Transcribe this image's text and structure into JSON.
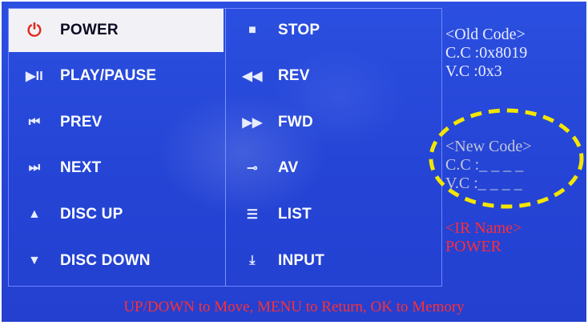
{
  "menu": {
    "left": [
      {
        "icon": "power-icon",
        "glyph": "⏻",
        "label": "POWER",
        "selected": true
      },
      {
        "icon": "play-pause-icon",
        "glyph": "▶II",
        "label": "PLAY/PAUSE"
      },
      {
        "icon": "prev-icon",
        "glyph": "⏮",
        "label": "PREV"
      },
      {
        "icon": "next-icon",
        "glyph": "⏭",
        "label": "NEXT"
      },
      {
        "icon": "disc-up-icon",
        "glyph": "▲",
        "label": "DISC UP"
      },
      {
        "icon": "disc-down-icon",
        "glyph": "▼",
        "label": "DISC DOWN"
      }
    ],
    "right": [
      {
        "icon": "stop-icon",
        "glyph": "■",
        "label": "STOP"
      },
      {
        "icon": "rev-icon",
        "glyph": "◀◀",
        "label": "REV"
      },
      {
        "icon": "fwd-icon",
        "glyph": "▶▶",
        "label": "FWD"
      },
      {
        "icon": "av-icon",
        "glyph": "⊸",
        "label": "AV"
      },
      {
        "icon": "list-icon",
        "glyph": "☰",
        "label": "LIST"
      },
      {
        "icon": "input-icon",
        "glyph": "⤓",
        "label": "INPUT"
      }
    ]
  },
  "info": {
    "old_code": {
      "heading": "<Old Code>",
      "cc": "C.C :0x8019",
      "vc": "V.C :0x3"
    },
    "new_code": {
      "heading": "<New Code>",
      "cc": "C.C :_ _ _ _",
      "vc": "V.C :_ _ _ _"
    },
    "ir_name": {
      "heading": "<IR Name>",
      "value": "POWER"
    }
  },
  "footer": {
    "instructions": "UP/DOWN to Move, MENU to Return, OK to Memory"
  },
  "colors": {
    "background": "#2a49d8",
    "selected_bg": "#f2f2f6",
    "footer_text": "#ff3034",
    "highlight_ring": "#f5e600"
  }
}
